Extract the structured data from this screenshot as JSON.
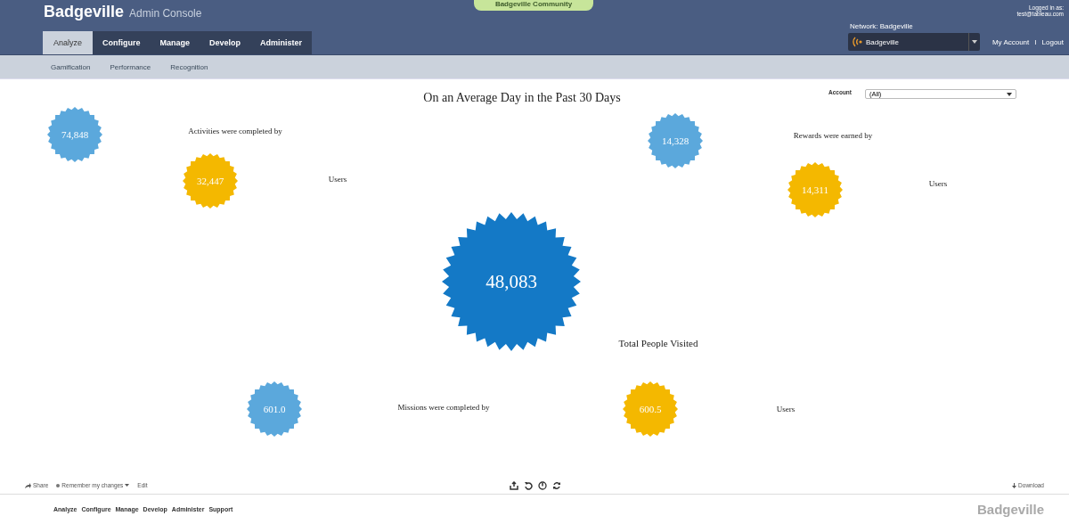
{
  "header": {
    "logo": "Badgeville",
    "subtitle": "Admin Console",
    "community_tab": "Badgeville Community",
    "logged_in_label": "Logged in as:",
    "logged_in_user": "test@tableau.com",
    "network_label": "Network: Badgeville",
    "network_select": "Badgeville",
    "links": [
      "My Account",
      "Logout"
    ],
    "separator": "I"
  },
  "tabs": [
    {
      "label": "Analyze",
      "selected": true
    },
    {
      "label": "Configure",
      "selected": false
    },
    {
      "label": "Manage",
      "selected": false
    },
    {
      "label": "Develop",
      "selected": false
    },
    {
      "label": "Administer",
      "selected": false
    }
  ],
  "subnav": [
    "Gamification",
    "Performance",
    "Recognition"
  ],
  "dashboard": {
    "title": "On an Average Day in the Past 30 Days",
    "filter_label": "Account",
    "filter_value": "(All)",
    "badges": [
      {
        "value": "74,848",
        "kind": "small-blue"
      },
      {
        "value": "32,447",
        "kind": "small-yellow"
      },
      {
        "value": "14,328",
        "kind": "small-blue"
      },
      {
        "value": "14,311",
        "kind": "small-yellow"
      },
      {
        "value": "48,083",
        "kind": "large"
      },
      {
        "value": "601.0",
        "kind": "small-blue"
      },
      {
        "value": "600.5",
        "kind": "small-yellow"
      }
    ],
    "captions": [
      "Activities were completed by",
      "Users",
      "Rewards were earned by",
      "Users",
      "Total People Visited",
      "Missions were completed by",
      "Users"
    ]
  },
  "toolbar": {
    "share": "Share",
    "remember": "Remember my changes",
    "edit": "Edit",
    "download": "Download"
  },
  "footer": {
    "links": [
      "Analyze",
      "Configure",
      "Manage",
      "Develop",
      "Administer",
      "Support"
    ],
    "logo": "Badgeville"
  }
}
